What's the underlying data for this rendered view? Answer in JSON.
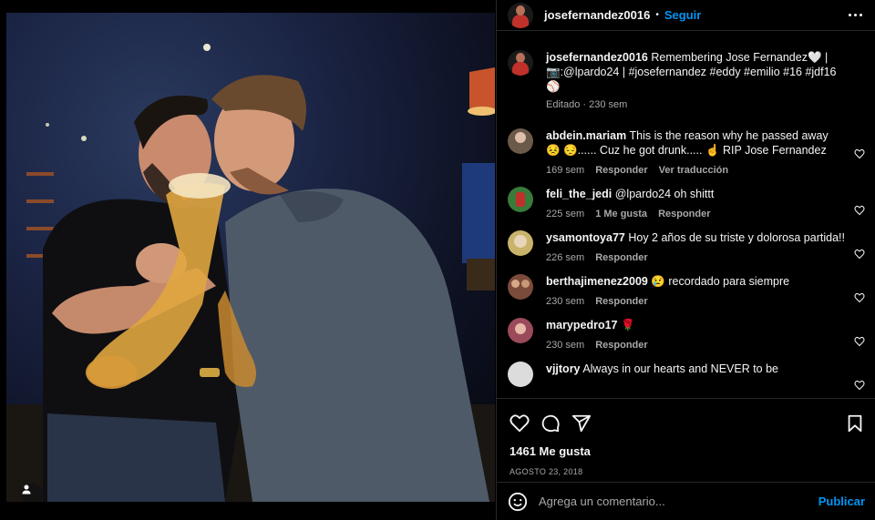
{
  "post": {
    "author": "josefernandez0016",
    "follow_label": "Seguir",
    "dot": "•",
    "caption_text": "Remembering Jose Fernandez🤍 | 📷:@lpardo24 | #josefernandez #eddy #emilio #16 #jdf16 ⚾",
    "caption_meta": "Editado · 230 sem"
  },
  "comments": [
    {
      "user": "abdein.mariam",
      "text": "This is the reason why he passed away 😣 😔...... Cuz he got drunk..... ☝️ RIP Jose Fernandez",
      "time": "169 sem",
      "likes": "",
      "reply": "Responder",
      "translate": "Ver traducción",
      "avatar_color": "#6b5a4a"
    },
    {
      "user": "feli_the_jedi",
      "text": "@lpardo24 oh shittt",
      "time": "225 sem",
      "likes": "1 Me gusta",
      "reply": "Responder",
      "translate": "",
      "avatar_color": "#3a7a3a"
    },
    {
      "user": "ysamontoya77",
      "text": "Hoy 2 años de su triste y dolorosa partida!!",
      "time": "226 sem",
      "likes": "",
      "reply": "Responder",
      "translate": "",
      "avatar_color": "#c9b26a"
    },
    {
      "user": "berthajimenez2009",
      "text": "😢 recordado para siempre",
      "time": "230 sem",
      "likes": "",
      "reply": "Responder",
      "translate": "",
      "avatar_color": "#7a4a3a"
    },
    {
      "user": "marypedro17",
      "text": "🌹",
      "time": "230 sem",
      "likes": "",
      "reply": "Responder",
      "translate": "",
      "avatar_color": "#9a4a5a"
    },
    {
      "user": "vjjtory",
      "text": "Always in our hearts and NEVER to be",
      "time": "",
      "likes": "",
      "reply": "",
      "translate": "",
      "avatar_color": "#dcdcdc"
    }
  ],
  "engagement": {
    "likes": "1461 Me gusta",
    "date": "AGOSTO 23, 2018"
  },
  "composer": {
    "placeholder": "Agrega un comentario...",
    "post_label": "Publicar"
  }
}
